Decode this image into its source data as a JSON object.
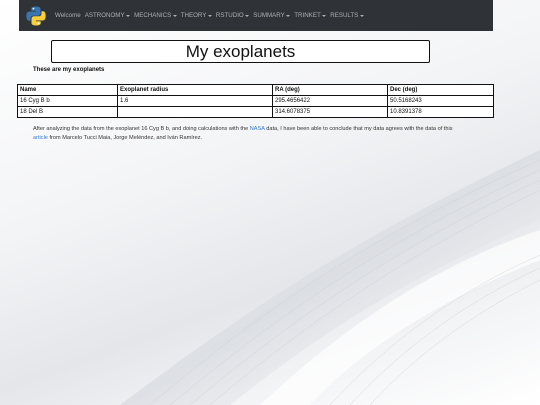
{
  "navbar": {
    "welcome": "Welcome",
    "menus": [
      {
        "label": "ASTRONOMY"
      },
      {
        "label": "MECHANICS"
      },
      {
        "label": "THEORY"
      },
      {
        "label": "RSTUDIO"
      },
      {
        "label": "SUMMARY"
      },
      {
        "label": "TRINKET"
      },
      {
        "label": "RESULTS"
      }
    ]
  },
  "page": {
    "title": "My exoplanets",
    "subtitle": "These are my exoplanets"
  },
  "table": {
    "headers": [
      "Name",
      "Exoplanet radius",
      "RA (deg)",
      "Dec (deg)"
    ],
    "rows": [
      [
        "16 Cyg B b",
        "1.6",
        "295.4656422",
        "50.5168243"
      ],
      [
        "18 Del B",
        "",
        "314.6078375",
        "10.8391378"
      ]
    ]
  },
  "paragraph": {
    "part1": "After analyzing the data from the exoplanet 16 Cyg B b, and doing calculations with the ",
    "link1": "NASA",
    "part2": " data, I have been able to conclude that my data agrees with the data of this ",
    "link2": "article",
    "part3": " from Marcelo Tucci Maia, Jorge Meléndez, and Iván Ramírez."
  },
  "colors": {
    "navbar_bg": "#2f3337",
    "nav_text": "#a9b0b6",
    "link": "#2b7cd3",
    "python_blue": "#3a75b0",
    "python_yellow": "#f7cf3c"
  },
  "icons": {
    "logo": "python-logo-icon"
  }
}
